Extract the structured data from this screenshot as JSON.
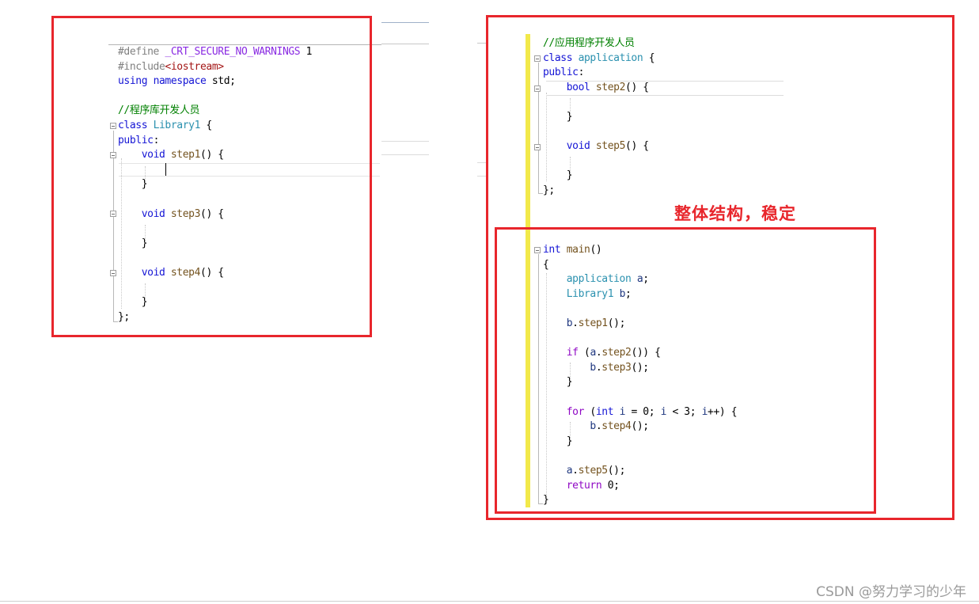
{
  "left_panel": {
    "lines": [
      {
        "parts": [
          [
            "pp",
            "#define "
          ],
          [
            "mac",
            "_CRT_SECURE_NO_WARNINGS"
          ],
          [
            "txt",
            " 1"
          ]
        ]
      },
      {
        "parts": [
          [
            "pp",
            "#include"
          ],
          [
            "inc",
            "<iostream>"
          ]
        ]
      },
      {
        "parts": [
          [
            "kw",
            "using"
          ],
          [
            "txt",
            " "
          ],
          [
            "kw",
            "namespace"
          ],
          [
            "txt",
            " std;"
          ]
        ]
      },
      {
        "parts": []
      },
      {
        "parts": [
          [
            "cm",
            "//程序库开发人员"
          ]
        ]
      },
      {
        "parts": [
          [
            "kw",
            "class"
          ],
          [
            "txt",
            " "
          ],
          [
            "cls",
            "Library1"
          ],
          [
            "txt",
            " {"
          ]
        ]
      },
      {
        "parts": [
          [
            "kw",
            "public"
          ],
          [
            "txt",
            ":"
          ]
        ]
      },
      {
        "parts": [
          [
            "txt",
            "    "
          ],
          [
            "kw",
            "void"
          ],
          [
            "txt",
            " "
          ],
          [
            "fn",
            "step1"
          ],
          [
            "txt",
            "() {"
          ]
        ]
      },
      {
        "parts": []
      },
      {
        "parts": [
          [
            "txt",
            "    }"
          ]
        ]
      },
      {
        "parts": []
      },
      {
        "parts": [
          [
            "txt",
            "    "
          ],
          [
            "kw",
            "void"
          ],
          [
            "txt",
            " "
          ],
          [
            "fn",
            "step3"
          ],
          [
            "txt",
            "() {"
          ]
        ]
      },
      {
        "parts": []
      },
      {
        "parts": [
          [
            "txt",
            "    }"
          ]
        ]
      },
      {
        "parts": []
      },
      {
        "parts": [
          [
            "txt",
            "    "
          ],
          [
            "kw",
            "void"
          ],
          [
            "txt",
            " "
          ],
          [
            "fn",
            "step4"
          ],
          [
            "txt",
            "() {"
          ]
        ]
      },
      {
        "parts": []
      },
      {
        "parts": [
          [
            "txt",
            "    }"
          ]
        ]
      },
      {
        "parts": [
          [
            "txt",
            "};"
          ]
        ]
      }
    ]
  },
  "right_panel_top": {
    "lines": [
      {
        "parts": [
          [
            "cm",
            "//应用程序开发人员"
          ]
        ]
      },
      {
        "parts": [
          [
            "kw",
            "class"
          ],
          [
            "txt",
            " "
          ],
          [
            "cls",
            "application"
          ],
          [
            "txt",
            " {"
          ]
        ]
      },
      {
        "parts": [
          [
            "kw",
            "public"
          ],
          [
            "txt",
            ":"
          ]
        ]
      },
      {
        "parts": [
          [
            "txt",
            "    "
          ],
          [
            "kw",
            "bool"
          ],
          [
            "txt",
            " "
          ],
          [
            "fn",
            "step2"
          ],
          [
            "txt",
            "() {"
          ]
        ]
      },
      {
        "parts": []
      },
      {
        "parts": [
          [
            "txt",
            "    }"
          ]
        ]
      },
      {
        "parts": []
      },
      {
        "parts": [
          [
            "txt",
            "    "
          ],
          [
            "kw",
            "void"
          ],
          [
            "txt",
            " "
          ],
          [
            "fn",
            "step5"
          ],
          [
            "txt",
            "() {"
          ]
        ]
      },
      {
        "parts": []
      },
      {
        "parts": [
          [
            "txt",
            "    }"
          ]
        ]
      },
      {
        "parts": [
          [
            "txt",
            "};"
          ]
        ]
      }
    ]
  },
  "right_panel_main": {
    "lines": [
      {
        "parts": [
          [
            "kw",
            "int"
          ],
          [
            "txt",
            " "
          ],
          [
            "fn",
            "main"
          ],
          [
            "txt",
            "()"
          ]
        ]
      },
      {
        "parts": [
          [
            "txt",
            "{"
          ]
        ]
      },
      {
        "parts": [
          [
            "txt",
            "    "
          ],
          [
            "cls",
            "application"
          ],
          [
            "txt",
            " "
          ],
          [
            "var",
            "a"
          ],
          [
            "txt",
            ";"
          ]
        ]
      },
      {
        "parts": [
          [
            "txt",
            "    "
          ],
          [
            "cls",
            "Library1"
          ],
          [
            "txt",
            " "
          ],
          [
            "var",
            "b"
          ],
          [
            "txt",
            ";"
          ]
        ]
      },
      {
        "parts": []
      },
      {
        "parts": [
          [
            "txt",
            "    "
          ],
          [
            "var",
            "b"
          ],
          [
            "txt",
            "."
          ],
          [
            "fn",
            "step1"
          ],
          [
            "txt",
            "();"
          ]
        ]
      },
      {
        "parts": []
      },
      {
        "parts": [
          [
            "txt",
            "    "
          ],
          [
            "flow",
            "if"
          ],
          [
            "txt",
            " ("
          ],
          [
            "var",
            "a"
          ],
          [
            "txt",
            "."
          ],
          [
            "fn",
            "step2"
          ],
          [
            "txt",
            "()) {"
          ]
        ]
      },
      {
        "parts": [
          [
            "txt",
            "        "
          ],
          [
            "var",
            "b"
          ],
          [
            "txt",
            "."
          ],
          [
            "fn",
            "step3"
          ],
          [
            "txt",
            "();"
          ]
        ]
      },
      {
        "parts": [
          [
            "txt",
            "    }"
          ]
        ]
      },
      {
        "parts": []
      },
      {
        "parts": [
          [
            "txt",
            "    "
          ],
          [
            "flow",
            "for"
          ],
          [
            "txt",
            " ("
          ],
          [
            "kw",
            "int"
          ],
          [
            "txt",
            " "
          ],
          [
            "var",
            "i"
          ],
          [
            "txt",
            " = 0; "
          ],
          [
            "var",
            "i"
          ],
          [
            "txt",
            " < 3; "
          ],
          [
            "var",
            "i"
          ],
          [
            "txt",
            "++) {"
          ]
        ]
      },
      {
        "parts": [
          [
            "txt",
            "        "
          ],
          [
            "var",
            "b"
          ],
          [
            "txt",
            "."
          ],
          [
            "fn",
            "step4"
          ],
          [
            "txt",
            "();"
          ]
        ]
      },
      {
        "parts": [
          [
            "txt",
            "    }"
          ]
        ]
      },
      {
        "parts": []
      },
      {
        "parts": [
          [
            "txt",
            "    "
          ],
          [
            "var",
            "a"
          ],
          [
            "txt",
            "."
          ],
          [
            "fn",
            "step5"
          ],
          [
            "txt",
            "();"
          ]
        ]
      },
      {
        "parts": [
          [
            "txt",
            "    "
          ],
          [
            "flow",
            "return"
          ],
          [
            "txt",
            " 0;"
          ]
        ]
      },
      {
        "parts": [
          [
            "txt",
            "}"
          ]
        ]
      }
    ]
  },
  "annotation": "整体结构，稳定",
  "watermark": "CSDN @努力学习的少年",
  "colors": {
    "box_red": "#e8262c",
    "change_bar_yellow": "#f2e94a",
    "annotation_red": "#e8262c"
  }
}
